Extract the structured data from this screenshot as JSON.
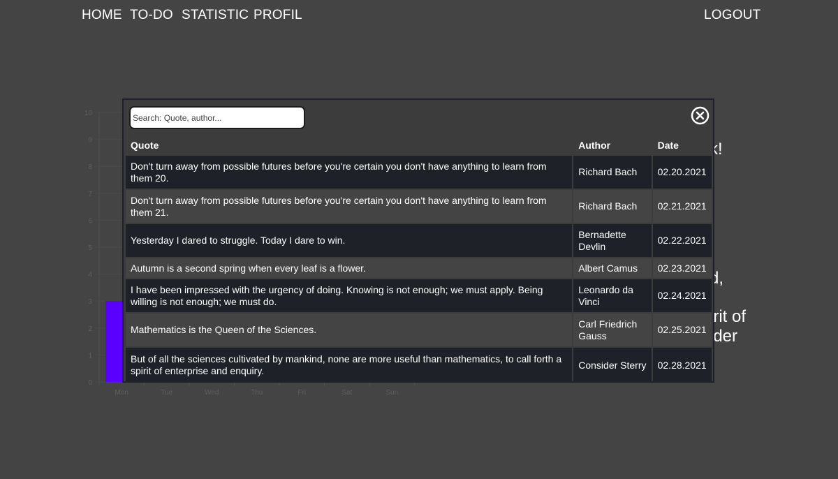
{
  "nav": {
    "left": [
      "HOME",
      "TO-DO",
      "STATISTIC",
      "PROFIL"
    ],
    "right": "LOGOUT"
  },
  "background": {
    "fragments": [
      "k!",
      "d,",
      "irit of",
      "ider"
    ]
  },
  "chart_data": {
    "type": "bar",
    "categories": [
      "Mon",
      "Tue",
      "Wed",
      "Thu",
      "Fri",
      "Sat",
      "Sun"
    ],
    "values": [
      3,
      0,
      0,
      0,
      0,
      0,
      0
    ],
    "ylim": [
      0,
      10
    ],
    "yticks": [
      0,
      1,
      2,
      3,
      4,
      5,
      6,
      7,
      8,
      9,
      10
    ],
    "bar_color": "#5a00ff"
  },
  "modal": {
    "search": {
      "placeholder": "Search: Quote, author...",
      "value": ""
    },
    "close_icon": "close-circle-icon",
    "columns": [
      "Quote",
      "Author",
      "Date"
    ],
    "rows": [
      {
        "quote": "Don't turn away from possible futures before you're certain you don't have anything to learn from them 20.",
        "author": "Richard Bach",
        "date": "02.20.2021"
      },
      {
        "quote": "Don't turn away from possible futures before you're certain you don't have anything to learn from them 21.",
        "author": "Richard Bach",
        "date": "02.21.2021"
      },
      {
        "quote": "Yesterday I dared to struggle. Today I dare to win.",
        "author": "Bernadette Devlin",
        "date": "02.22.2021"
      },
      {
        "quote": "Autumn is a second spring when every leaf is a flower.",
        "author": "Albert Camus",
        "date": "02.23.2021"
      },
      {
        "quote": "I have been impressed with the urgency of doing. Knowing is not enough; we must apply. Being willing is not enough; we must do.",
        "author": "Leonardo da Vinci",
        "date": "02.24.2021"
      },
      {
        "quote": "Mathematics is the Queen of the Sciences.",
        "author": "Carl Friedrich Gauss",
        "date": "02.25.2021"
      },
      {
        "quote": "But of all the sciences cultivated by mankind, none are more useful than mathematics, to call forth a spirit of enterprise and enquiry.",
        "author": "Consider Sterry",
        "date": "02.28.2021"
      }
    ]
  },
  "colors": {
    "page_bg": "#444444",
    "modal_bg": "#3c3c3c",
    "row_dark": "#1e2127",
    "row_light": "#444444",
    "accent": "#5a00ff"
  }
}
